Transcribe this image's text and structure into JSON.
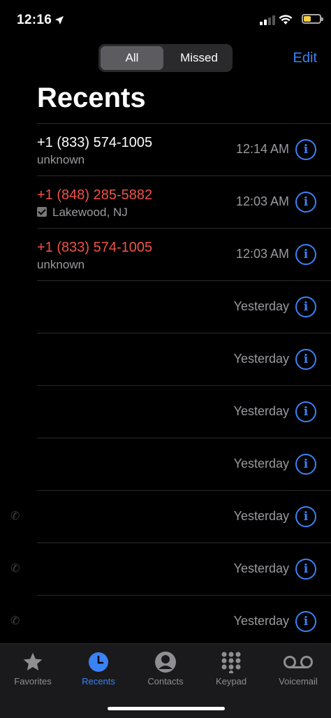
{
  "status": {
    "time": "12:16"
  },
  "segment": {
    "all": "All",
    "missed": "Missed"
  },
  "edit_label": "Edit",
  "title": "Recents",
  "calls": [
    {
      "name": "+1 (833) 574-1005",
      "sub": "unknown",
      "time": "12:14 AM",
      "missed": false,
      "checked": false
    },
    {
      "name": "+1 (848) 285-5882",
      "sub": "Lakewood, NJ",
      "time": "12:03 AM",
      "missed": true,
      "checked": true
    },
    {
      "name": "+1 (833) 574-1005",
      "sub": "unknown",
      "time": "12:03 AM",
      "missed": true,
      "checked": false
    },
    {
      "name": "",
      "sub": "",
      "time": "Yesterday",
      "missed": false,
      "checked": false
    },
    {
      "name": "",
      "sub": "",
      "time": "Yesterday",
      "missed": false,
      "checked": false
    },
    {
      "name": "",
      "sub": "",
      "time": "Yesterday",
      "missed": false,
      "checked": false
    },
    {
      "name": "",
      "sub": "",
      "time": "Yesterday",
      "missed": false,
      "checked": false
    },
    {
      "name": "",
      "sub": "",
      "time": "Yesterday",
      "missed": false,
      "checked": false
    },
    {
      "name": "",
      "sub": "",
      "time": "Yesterday",
      "missed": false,
      "checked": false
    },
    {
      "name": "",
      "sub": "",
      "time": "Yesterday",
      "missed": false,
      "checked": false
    }
  ],
  "tabs": [
    {
      "label": "Favorites",
      "icon": "star-icon"
    },
    {
      "label": "Recents",
      "icon": "clock-icon",
      "active": true
    },
    {
      "label": "Contacts",
      "icon": "person-icon"
    },
    {
      "label": "Keypad",
      "icon": "keypad-icon"
    },
    {
      "label": "Voicemail",
      "icon": "voicemail-icon"
    }
  ],
  "colors": {
    "accent": "#3b82f6",
    "missed": "#f0524a",
    "battery": "#f4d044"
  }
}
